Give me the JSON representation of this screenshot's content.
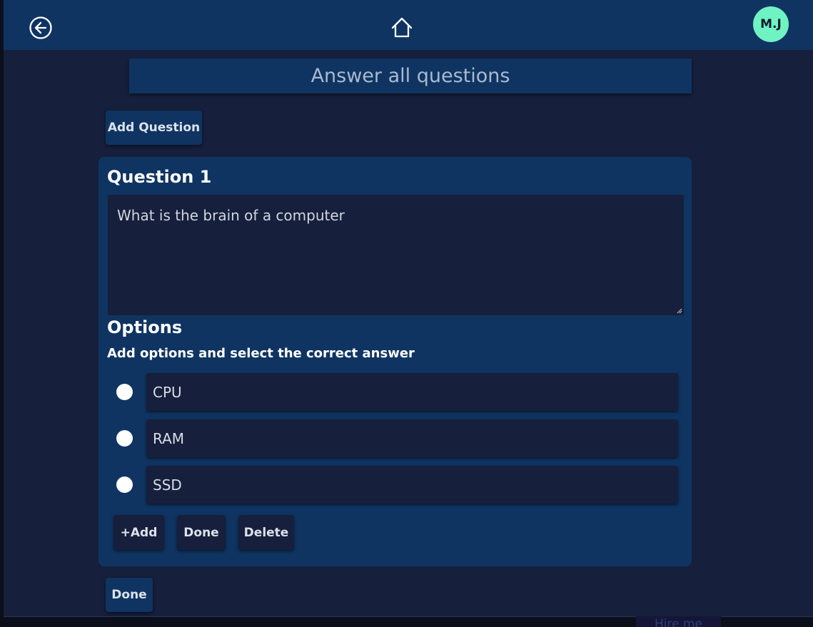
{
  "topbar": {
    "back_icon": "arrow-left-circle-icon",
    "home_icon": "home-icon",
    "avatar_initials": "M.J"
  },
  "page": {
    "title": "Answer all questions",
    "add_question_label": "Add Question",
    "done_label": "Done"
  },
  "question": {
    "title": "Question 1",
    "text": "What is the brain of a computer",
    "options_title": "Options",
    "options_hint": "Add options and select the correct answer",
    "options": [
      {
        "label": "CPU",
        "selected": false
      },
      {
        "label": "RAM",
        "selected": false
      },
      {
        "label": "SSD",
        "selected": false
      }
    ],
    "add_option_label": "+Add",
    "done_label": "Done",
    "delete_label": "Delete"
  },
  "footer": {
    "hire_me_label": "Hire me"
  },
  "colors": {
    "background": "#161f3b",
    "panel": "#0f3462",
    "avatar": "#6ff3c3",
    "text": "#ffffff"
  }
}
